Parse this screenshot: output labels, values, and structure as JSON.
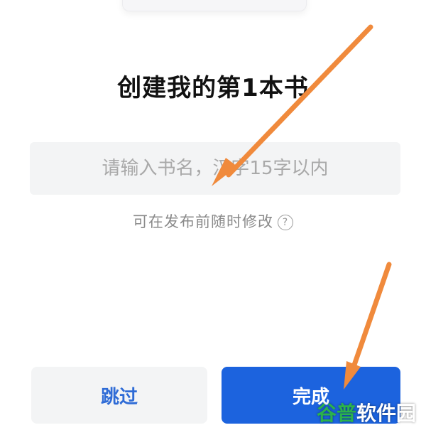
{
  "page": {
    "title": "创建我的第1本书",
    "book_name_input": {
      "value": "",
      "placeholder": "请输入书名，汉字15字以内"
    },
    "hint_text": "可在发布前随时修改",
    "help_icon_glyph": "?",
    "skip_label": "跳过",
    "done_label": "完成"
  },
  "watermark": {
    "accent": "谷普",
    "text": "软件园"
  },
  "colors": {
    "primary": "#1c63de",
    "skip_text": "#2e6bd6",
    "arrow": "#f08a3c"
  },
  "icons": {
    "help": "question-circle-icon",
    "annotation": "orange-arrow"
  }
}
